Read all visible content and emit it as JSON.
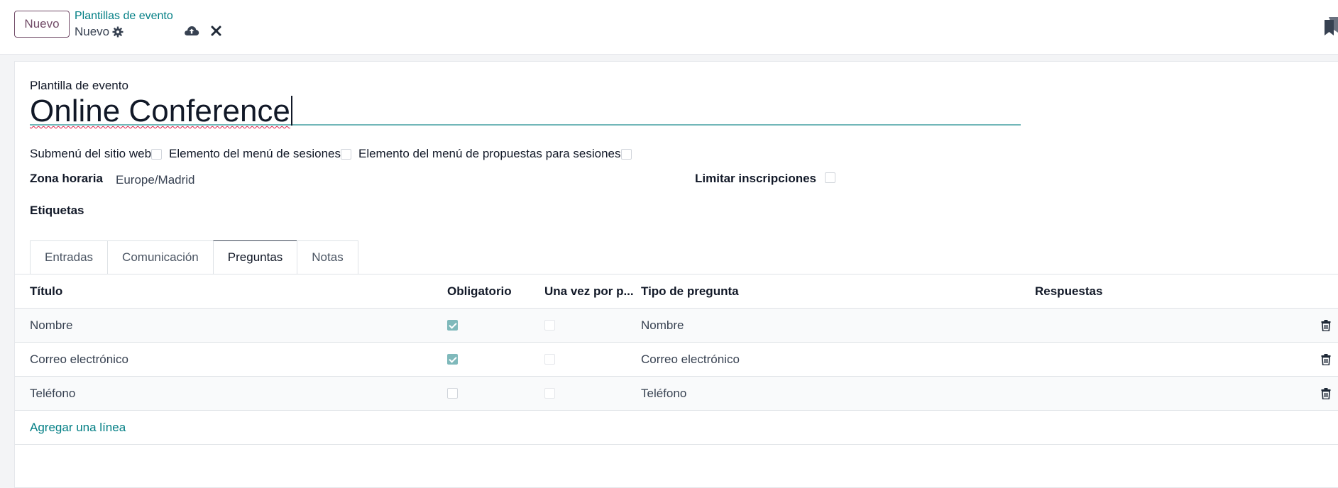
{
  "control_panel": {
    "new_button": "Nuevo",
    "breadcrumb_parent": "Plantillas de evento",
    "breadcrumb_current": "Nuevo"
  },
  "form": {
    "template_label": "Plantilla de evento",
    "template_name": "Online Conference",
    "checkboxes": [
      {
        "label": "Submenú del sitio web",
        "checked": false
      },
      {
        "label": "Elemento del menú de sesiones",
        "checked": false
      },
      {
        "label": "Elemento del menú de propuestas para sesiones",
        "checked": false
      }
    ],
    "timezone_label": "Zona horaria",
    "timezone_value": "Europe/Madrid",
    "limit_label": "Limitar inscripciones",
    "tags_label": "Etiquetas"
  },
  "tabs": [
    {
      "label": "Entradas",
      "active": false
    },
    {
      "label": "Comunicación",
      "active": false
    },
    {
      "label": "Preguntas",
      "active": true
    },
    {
      "label": "Notas",
      "active": false
    }
  ],
  "questions_table": {
    "headers": {
      "title": "Título",
      "mandatory": "Obligatorio",
      "once_per": "Una vez por p...",
      "question_type": "Tipo de pregunta",
      "answers": "Respuestas"
    },
    "rows": [
      {
        "title": "Nombre",
        "mandatory": true,
        "once_per_order": false,
        "question_type": "Nombre"
      },
      {
        "title": "Correo electrónico",
        "mandatory": true,
        "once_per_order": false,
        "question_type": "Correo electrónico"
      },
      {
        "title": "Teléfono",
        "mandatory": false,
        "once_per_order": false,
        "question_type": "Teléfono"
      }
    ],
    "add_line": "Agregar una línea"
  },
  "icons": {
    "settings": "gear-icon",
    "save": "cloud-upload-icon",
    "discard": "close-icon",
    "delete": "trash-icon",
    "activity": "bookmark-icon"
  },
  "colors": {
    "primary": "#714b67",
    "link": "#017e84",
    "checkbox_checked": "#7fb9bb",
    "focus_underline": "#72b7b9"
  }
}
